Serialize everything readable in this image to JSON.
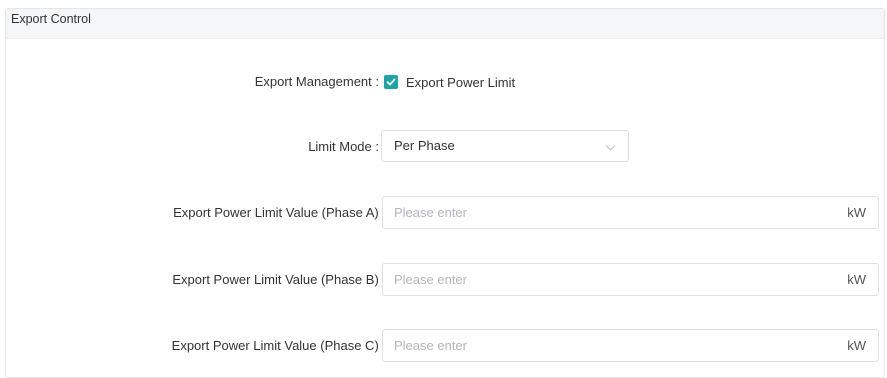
{
  "panel": {
    "title": "Export Control"
  },
  "form": {
    "export_management": {
      "label": "Export Management :",
      "checkbox_label": "Export Power Limit",
      "checked": true
    },
    "limit_mode": {
      "label": "Limit Mode :",
      "selected": "Per Phase"
    },
    "phase_a": {
      "label": "Export Power Limit Value (Phase A) :",
      "placeholder": "Please enter",
      "value": "",
      "unit": "kW"
    },
    "phase_b": {
      "label": "Export Power Limit Value (Phase B) :",
      "placeholder": "Please enter",
      "value": "",
      "unit": "kW"
    },
    "phase_c": {
      "label": "Export Power Limit Value (Phase C) :",
      "placeholder": "Please enter",
      "value": "",
      "unit": "kW"
    }
  },
  "icons": {
    "checkbox": "checkmark-icon",
    "select": "chevron-down-icon"
  },
  "colors": {
    "accent": "#1aa6a6",
    "border": "#dcdfe6",
    "header_bg": "#f5f6f8",
    "placeholder": "#b3b6bc"
  }
}
